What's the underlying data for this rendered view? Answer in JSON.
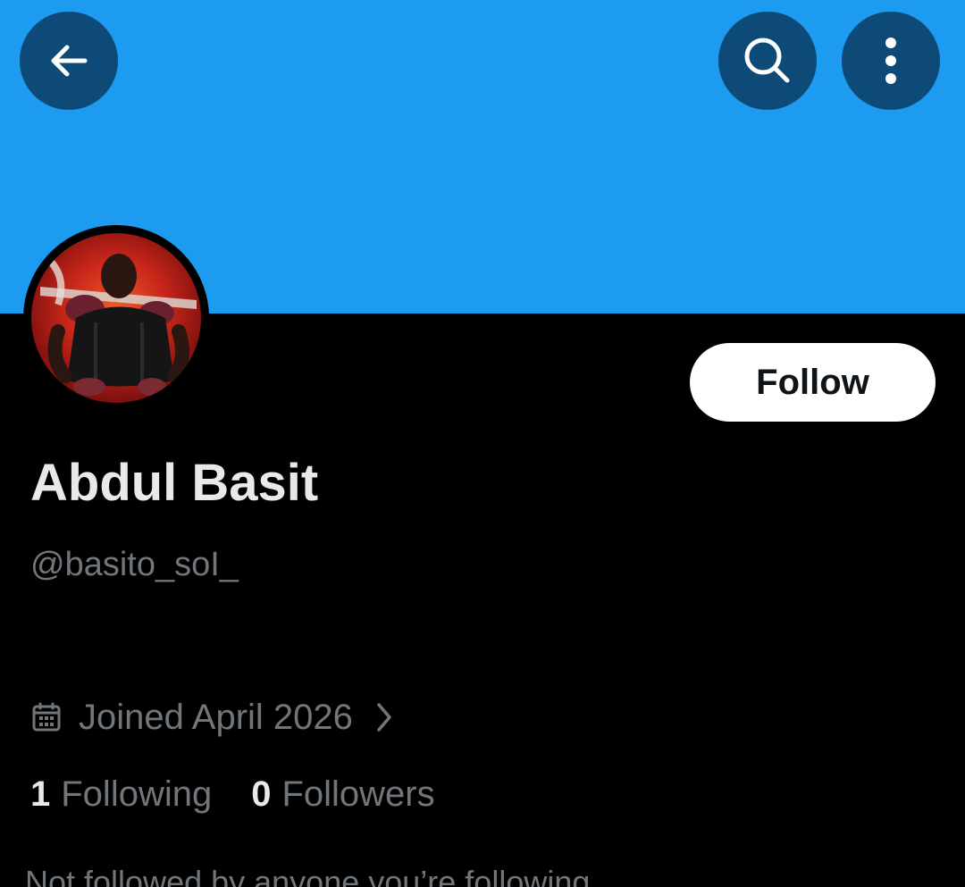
{
  "profile": {
    "display_name": "Abdul Basit",
    "handle": "@basito_soI_",
    "joined": "Joined April 2026",
    "following_count": "1",
    "following_label": "Following",
    "followers_count": "0",
    "followers_label": "Followers",
    "not_followed_text": "Not followed by anyone you’re following"
  },
  "actions": {
    "follow_label": "Follow"
  },
  "icons": {
    "back": "arrow-left-icon",
    "search": "search-icon",
    "more": "more-vertical-icon",
    "calendar": "calendar-icon",
    "chevron": "chevron-right-icon"
  },
  "colors": {
    "banner": "#1d9bf0",
    "background": "#000000",
    "icon_button": "#0e4a78",
    "primary_text": "#e7e9ea",
    "secondary_text": "#71767b",
    "follow_button_bg": "#ffffff",
    "follow_button_text": "#0f1419"
  }
}
